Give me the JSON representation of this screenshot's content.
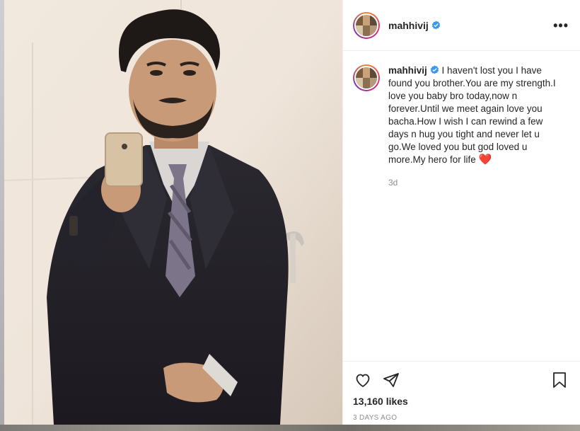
{
  "post": {
    "username": "mahhivij",
    "caption": "I haven't lost you I have found you brother.You are my strength.I love you baby bro today,now n forever.Until we meet again love you bacha.How I wish I can rewind a few days n hug you tight and never let u go.We loved you but god loved u more.My hero for life",
    "emoji": "❤️",
    "relative_time": "3d",
    "likes": "13,160 likes",
    "date": "3 DAYS AGO"
  },
  "icons": {
    "more": "more-options-icon",
    "verified": "verified-badge-icon",
    "like": "heart-icon",
    "share": "paper-plane-icon",
    "save": "bookmark-icon"
  },
  "colors": {
    "verified": "#3897f0",
    "heart_emoji": "#ed1c24",
    "muted_text": "#8e8e8e"
  }
}
